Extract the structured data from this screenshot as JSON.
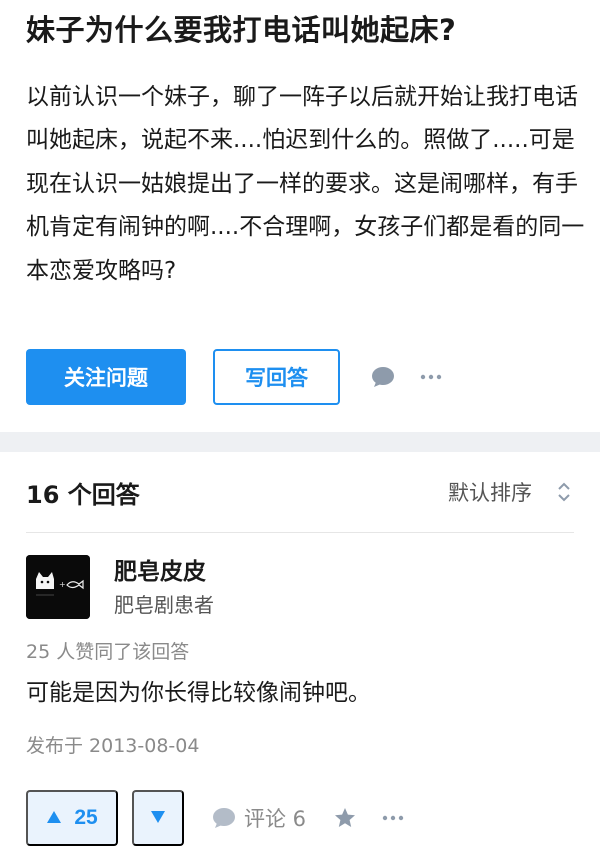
{
  "question": {
    "title": "妹子为什么要我打电话叫她起床?",
    "body": "以前认识一个妹子，聊了一阵子以后就开始让我打电话叫她起床，说起不来....怕迟到什么的。照做了.....可是现在认识一姑娘提出了一样的要求。这是闹哪样，有手机肯定有闹钟的啊....不合理啊，女孩子们都是看的同一本恋爱攻略吗?",
    "follow_label": "关注问题",
    "answer_label": "写回答",
    "icons": {
      "comment": "comment-icon",
      "more": "more-icon"
    }
  },
  "answers_header": {
    "count_label": "16 个回答",
    "sort_label": "默认排序",
    "sort_icon": "sort-updown-icon"
  },
  "answer": {
    "author_name": "肥皂皮皮",
    "author_bio": "肥皂剧患者",
    "votes_text": "25 人赞同了该回答",
    "content": "可能是因为你长得比较像闹钟吧。",
    "published": "发布于 2013-08-04",
    "upvote_count": "25",
    "comment_label": "评论 6"
  },
  "colors": {
    "accent": "#1e8ff0",
    "accent_light": "#eaf3fd",
    "divider": "#eef0f3",
    "muted": "#8a8a8a"
  }
}
